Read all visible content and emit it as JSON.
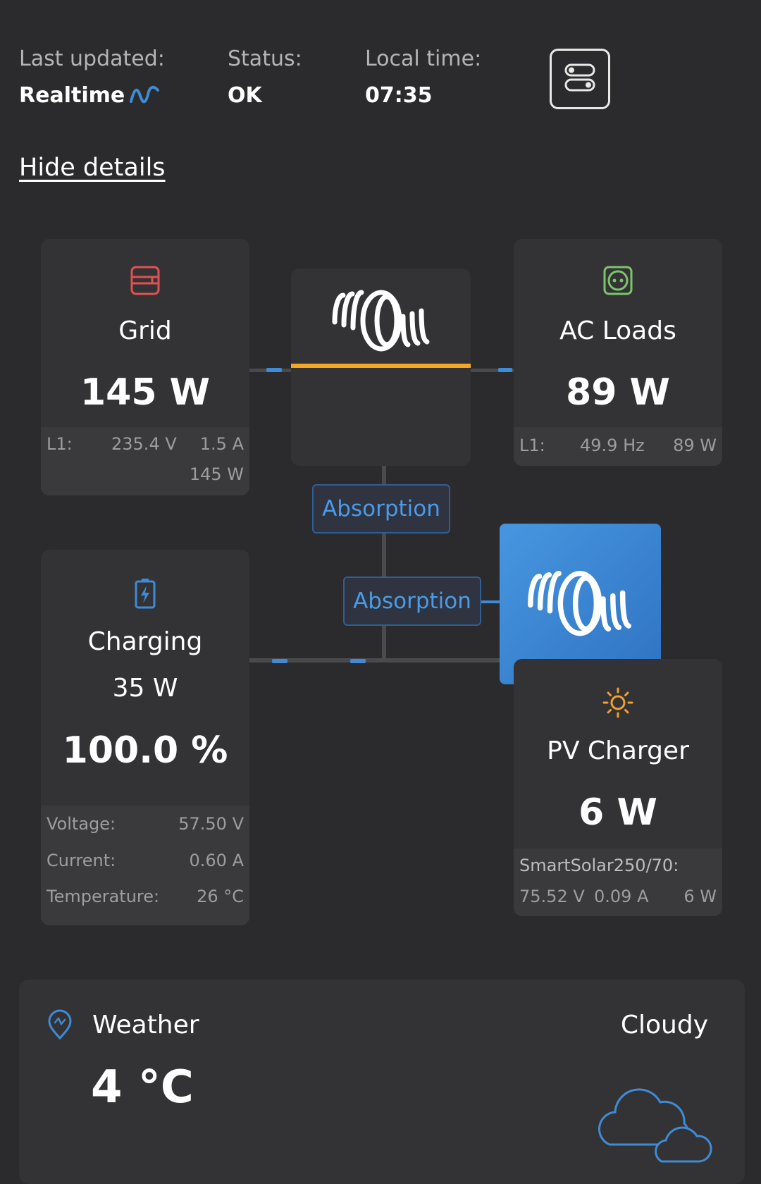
{
  "header": {
    "last_updated_label": "Last updated:",
    "last_updated_value": "Realtime",
    "status_label": "Status:",
    "status_value": "OK",
    "local_time_label": "Local time:",
    "local_time_value": "07:35"
  },
  "hide_details": "Hide details",
  "grid": {
    "title": "Grid",
    "power": "145 W",
    "phase": "L1:",
    "voltage": "235.4 V",
    "current": "1.5 A",
    "phase_power": "145 W"
  },
  "ac_loads": {
    "title": "AC Loads",
    "power": "89 W",
    "phase": "L1:",
    "frequency": "49.9 Hz",
    "phase_power": "89 W"
  },
  "inverter_state": "Absorption",
  "solar_state": "Absorption",
  "battery": {
    "title": "Charging",
    "power": "35 W",
    "soc": "100.0 %",
    "voltage_label": "Voltage:",
    "voltage": "57.50 V",
    "current_label": "Current:",
    "current": "0.60 A",
    "temperature_label": "Temperature:",
    "temperature": "26 °C"
  },
  "pv": {
    "title": "PV Charger",
    "power": "6 W",
    "device": "SmartSolar250/70:",
    "voltage": "75.52 V",
    "current": "0.09 A",
    "device_power": "6 W"
  },
  "weather": {
    "title": "Weather",
    "temperature": "4 °C",
    "condition": "Cloudy"
  },
  "colors": {
    "accent_blue": "#3f8bd6",
    "grid_red": "#e05252",
    "ac_green": "#7dc36b",
    "sun_orange": "#f0a030",
    "inverter_bar": "#f5a623",
    "solar_tile": "#3d85d4"
  },
  "icons": {
    "realtime": "wave-icon",
    "toggle": "toggle-switch-icon",
    "grid": "grid-meter-icon",
    "ac_loads": "socket-icon",
    "battery": "battery-charging-icon",
    "pv": "sun-icon",
    "weather_location": "location-pin-icon",
    "weather_condition": "cloud-icon",
    "brand": "victron-logo-icon"
  }
}
